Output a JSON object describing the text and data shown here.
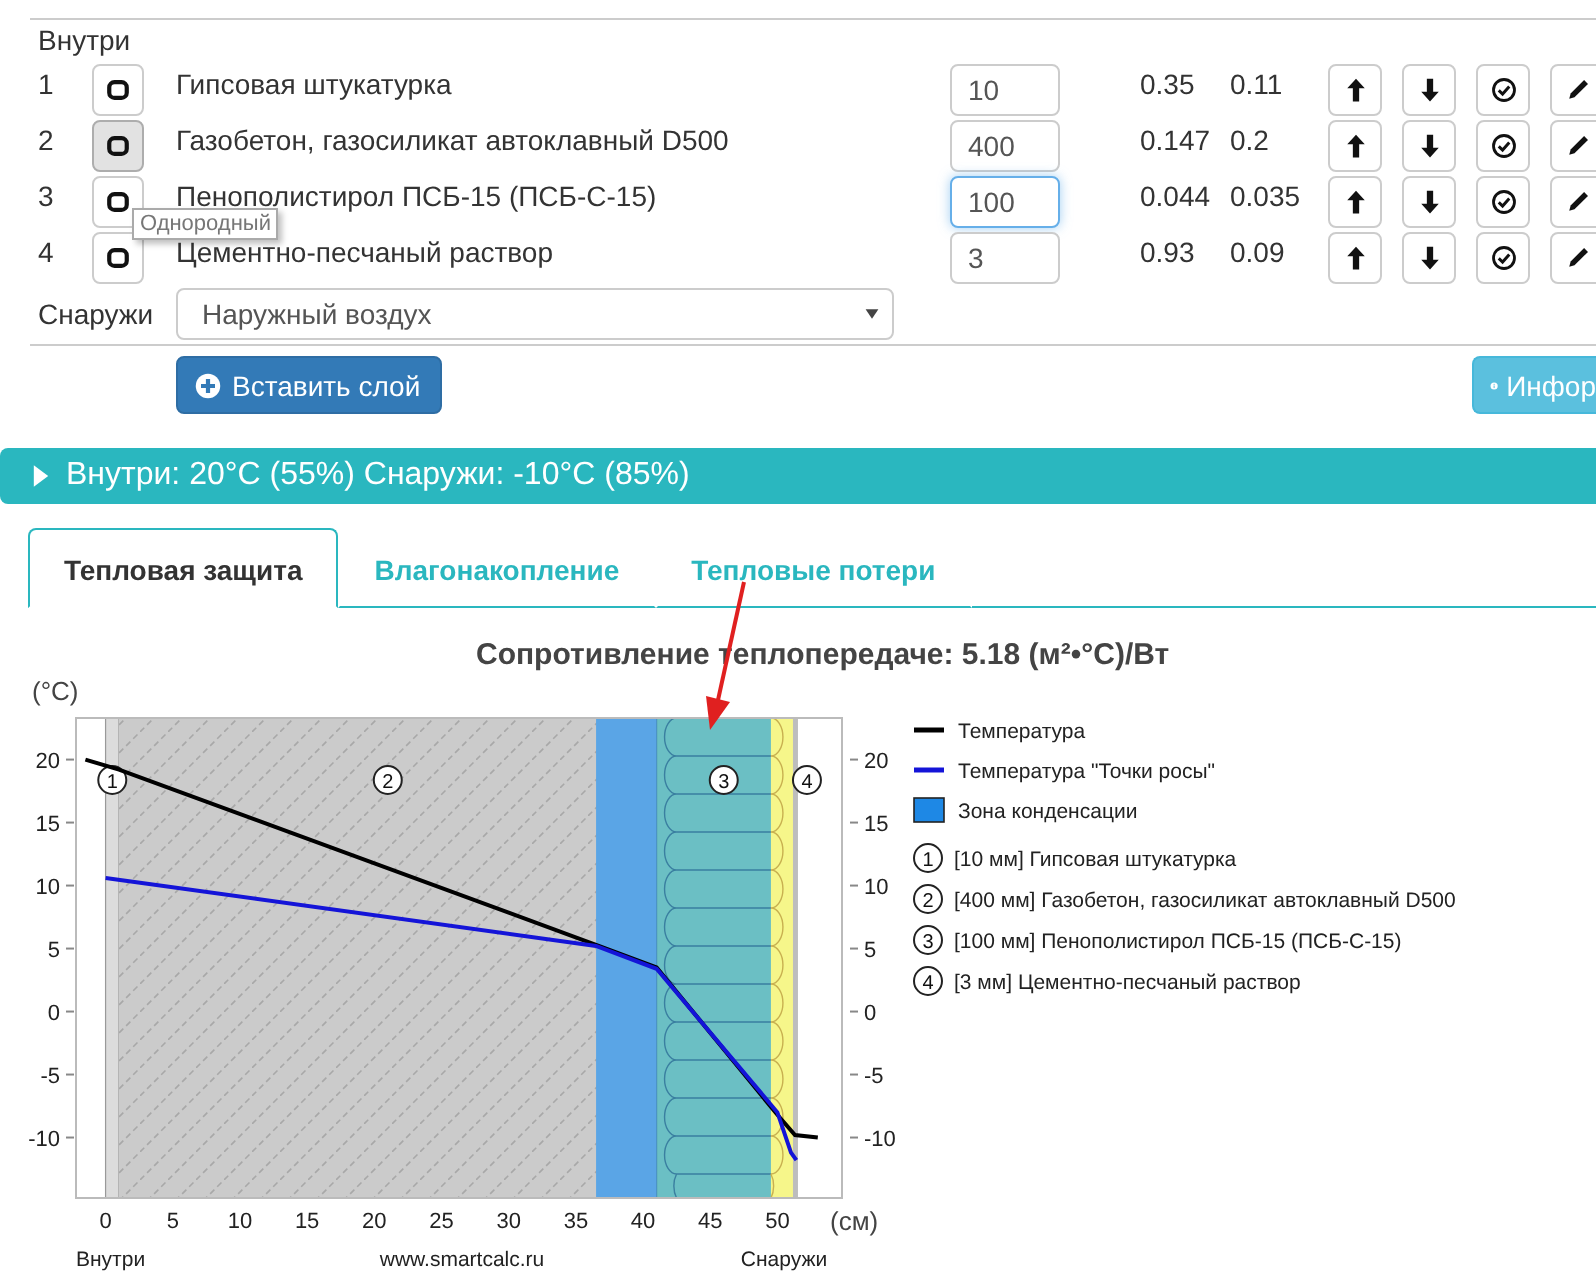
{
  "layers_table": {
    "inside_label": "Внутри",
    "rows": [
      {
        "number": "1",
        "pressed": false,
        "material": "Гипсовая штукатурка",
        "thickness": "10",
        "focused": false,
        "lambda": "0.35",
        "mu": "0.11"
      },
      {
        "number": "2",
        "pressed": true,
        "material": "Газобетон, газосиликат автоклавный D500",
        "thickness": "400",
        "focused": false,
        "lambda": "0.147",
        "mu": "0.2"
      },
      {
        "number": "3",
        "pressed": false,
        "material": "Пенополистирол ПСБ-15 (ПСБ-С-15)",
        "thickness": "100",
        "focused": true,
        "lambda": "0.044",
        "mu": "0.035"
      },
      {
        "number": "4",
        "pressed": false,
        "material": "Цементно-песчаный раствор",
        "thickness": "3",
        "focused": false,
        "lambda": "0.93",
        "mu": "0.09"
      }
    ],
    "outside_label": "Снаружи",
    "outside_select": "Наружный воздух",
    "tooltip": "Однородный"
  },
  "insert_button": "Вставить слой",
  "info_button": "Инфор",
  "conditions_bar": {
    "expanded": false,
    "text": "Внутри: 20°C (55%) Снаружи: -10°C (85%)"
  },
  "tabs": [
    {
      "label": "Тепловая защита",
      "selected": true
    },
    {
      "label": "Влагонакопление",
      "selected": false
    },
    {
      "label": "Тепловые потери",
      "selected": false
    }
  ],
  "chart": {
    "chart_data": {
      "type": "line",
      "title": "Сопротивление теплопередаче: 5.18 (м²•°C)/Вт",
      "xlabel": "(см)",
      "ylabel": "(°C)",
      "xlim": [
        -2.2,
        54.8
      ],
      "ylim": [
        -14.8,
        23.3
      ],
      "xticks": [
        0,
        5,
        10,
        15,
        20,
        25,
        30,
        35,
        40,
        45,
        50
      ],
      "yticks": [
        -10,
        -5,
        0,
        5,
        10,
        15,
        20
      ],
      "series": [
        {
          "name": "Температура",
          "color": "#000000",
          "x": [
            -1.5,
            1,
            36.5,
            41,
            50,
            51.3,
            53
          ],
          "values": [
            20,
            19.2,
            5.3,
            3.5,
            -8.2,
            -9.8,
            -10
          ]
        },
        {
          "name": "Температура \"Точки росы\"",
          "color": "#1414d8",
          "x": [
            0,
            36.5,
            41,
            50,
            51,
            51.4
          ],
          "values": [
            10.6,
            5.2,
            3.4,
            -8,
            -11.2,
            -11.8
          ]
        }
      ],
      "legend": "right"
    },
    "condensation_label": "Зона конденсации",
    "layers": [
      {
        "kind": "plaster",
        "marker": "1"
      },
      {
        "kind": "concrete",
        "marker": "2"
      },
      {
        "kind": "foam",
        "marker": "3"
      },
      {
        "kind": "mortar",
        "marker": "4"
      }
    ],
    "right_ticks": [
      "20",
      "15",
      "10",
      "5",
      "0",
      "-5",
      "-10"
    ],
    "layer_legend": [
      {
        "marker": "1",
        "text": "[10 мм] Гипсовая штукатурка"
      },
      {
        "marker": "2",
        "text": "[400 мм] Газобетон, газосиликат автоклавный D500"
      },
      {
        "marker": "3",
        "text": "[100 мм] Пенополистирол ПСБ-15 (ПСБ-С-15)"
      },
      {
        "marker": "4",
        "text": "[3 мм] Цементно-песчаный раствор"
      }
    ],
    "footer_labels": [
      "Внутри",
      "www.smartcalc.ru",
      "Снаружи"
    ]
  }
}
